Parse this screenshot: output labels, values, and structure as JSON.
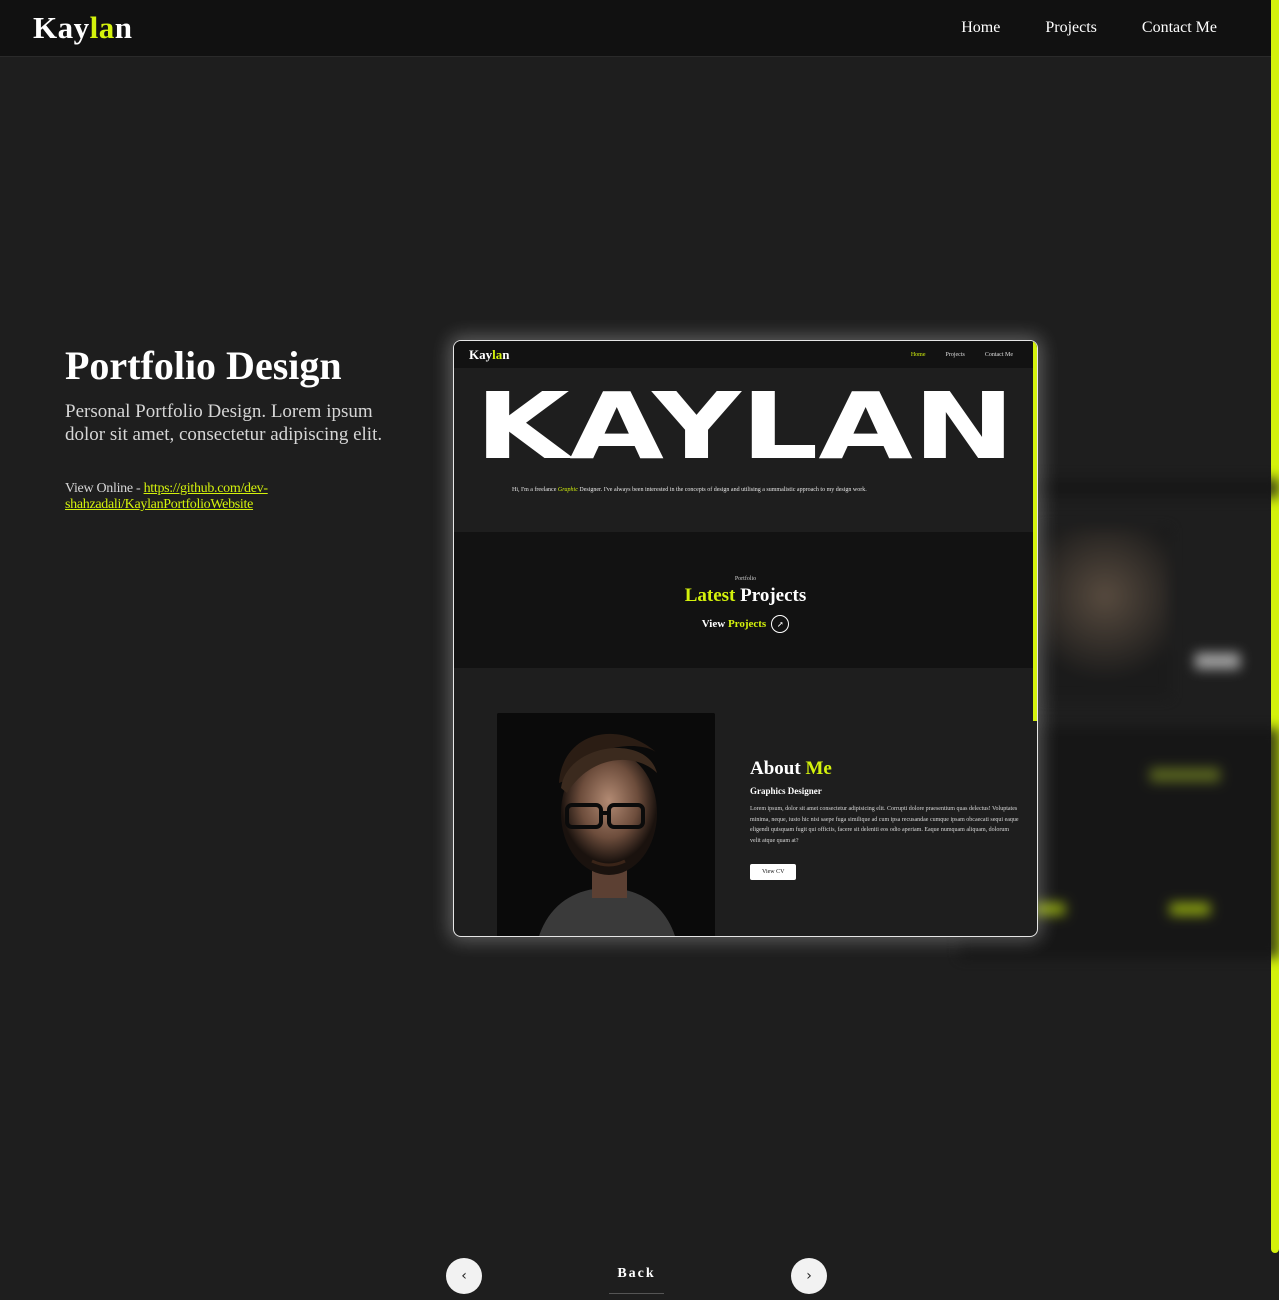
{
  "header": {
    "logo_pre": "Kay",
    "logo_accent": "la",
    "logo_post": "n",
    "nav": [
      "Home",
      "Projects",
      "Contact Me"
    ]
  },
  "project": {
    "title": "Portfolio Design",
    "description": "Personal Portfolio Design. Lorem ipsum dolor sit amet, consectetur adipiscing elit.",
    "online_label": "View Online - ",
    "online_url": "https://github.com/dev-shahzadali/KaylanPortfolioWebsite"
  },
  "preview": {
    "logo_pre": "Kay",
    "logo_accent": "la",
    "logo_post": "n",
    "nav": [
      "Home",
      "Projects",
      "Contact Me"
    ],
    "hero_text": "KAYLAN",
    "intro_pre": "Hi, I'm a freelance ",
    "intro_accent": "Graphic",
    "intro_post": " Designer. I've always been interested in the concepts of design and utilising a summalistic approach to my design work.",
    "portfolio_small": "Portfolio",
    "latest_accent": "Latest",
    "latest_rest": " Projects",
    "view_pre": "View ",
    "view_accent": "Projects",
    "about_pre": "About ",
    "about_accent": "Me",
    "about_role": "Graphics Designer",
    "about_body": "Lorem ipsum, dolor sit amet consectetur adipisicing elit. Corrupti dolore praesentium quas delectus! Voluptates minima, neque, iusto hic nisi saepe fuga similique ad cum ipsa recusandae cumque ipsam obcaecati sequi eaque eligendi quisquam fugit qui officiis, facere sit deleniti eos odio aperiam. Eaque numquam aliquam, dolorum velit atque quam at?",
    "cv_label": "View CV"
  },
  "controls": {
    "prev_icon": "‹",
    "next_icon": "›",
    "back_label": "Back"
  },
  "colors": {
    "accent": "#d4f20c",
    "background": "#1e1e1e",
    "nav_bg": "#111111"
  }
}
